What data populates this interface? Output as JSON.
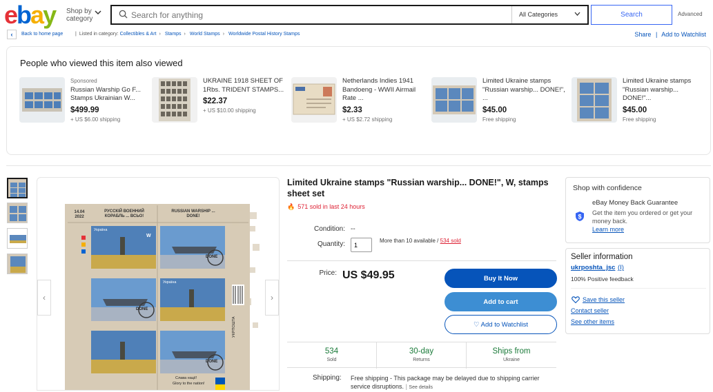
{
  "header": {
    "logo_letters": [
      {
        "ch": "e",
        "color": "#e53238"
      },
      {
        "ch": "b",
        "color": "#0064d2"
      },
      {
        "ch": "a",
        "color": "#f5af02"
      },
      {
        "ch": "y",
        "color": "#86b817"
      }
    ],
    "shop_by_line1": "Shop by",
    "shop_by_line2": "category",
    "search_placeholder": "Search for anything",
    "category_select": "All Categories",
    "search_button": "Search",
    "advanced": "Advanced"
  },
  "breadcrumb": {
    "back_home": "Back to home page",
    "listed_in": "Listed in category:",
    "items": [
      "Collectibles & Art",
      "Stamps",
      "World Stamps",
      "Worldwide Postal History Stamps"
    ],
    "share": "Share",
    "add_watchlist": "Add to Watchlist"
  },
  "also_viewed": {
    "title": "People who viewed this item also viewed",
    "items": [
      {
        "sponsored": "Sponsored",
        "title": "Russian Warship Go F... Stamps Ukrainian W...",
        "price": "$499.99",
        "shipping": "+ US $6.00 shipping"
      },
      {
        "sponsored": "",
        "title": "UKRAINE 1918 SHEET OF 1Rbs. TRIDENT STAMPS...",
        "price": "$22.37",
        "shipping": "+ US $10.00 shipping"
      },
      {
        "sponsored": "",
        "title": "Netherlands Indies 1941 Bandoeng - WWII Airmail Rate ...",
        "price": "$2.33",
        "shipping": "+ US $2.72 shipping"
      },
      {
        "sponsored": "",
        "title": "Limited Ukraine stamps \"Russian warship... DONE!\", ...",
        "price": "$45.00",
        "shipping": "Free shipping"
      },
      {
        "sponsored": "",
        "title": "Limited Ukraine stamps \"Russian warship... DONE!\"...",
        "price": "$45.00",
        "shipping": "Free shipping"
      }
    ]
  },
  "item": {
    "title": "Limited Ukraine stamps \"Russian warship... DONE!\", W, stamps sheet set",
    "hot_text": "571 sold in last 24 hours",
    "condition_label": "Condition:",
    "condition_value": "--",
    "quantity_label": "Quantity:",
    "quantity_value": "1",
    "available": "More than 10 available /",
    "sold_link": "534 sold",
    "price_label": "Price:",
    "price": "US $49.95",
    "buy_now": "Buy It Now",
    "add_to_cart": "Add to cart",
    "add_to_watchlist": "Add to Watchlist",
    "stats": [
      {
        "big": "534",
        "small": "Sold"
      },
      {
        "big": "30-day",
        "small": "Returns"
      },
      {
        "big": "Ships from",
        "small": "Ukraine"
      }
    ],
    "shipping_label": "Shipping:",
    "shipping_value": "Free shipping - This package may be delayed due to shipping carrier service disruptions.",
    "see_details": "See details",
    "stamp_sheet_text": {
      "date": "14.04 2022",
      "left_header": "РУССКІЙ ВОЕННИЙ КОРАБЛЬ ... ВСЬО!",
      "right_header": "RUSSIAN WARSHIP ... DONE!",
      "country": "Україна",
      "value": "W",
      "done": "DONE",
      "slogan_ua": "Слава нації!",
      "slogan_en": "Glory to the nation!",
      "post": "УКРПОШТА"
    }
  },
  "confidence": {
    "title": "Shop with confidence",
    "mbg_title": "eBay Money Back Guarantee",
    "mbg_desc": "Get the item you ordered or get your money back.",
    "learn_more": "Learn more"
  },
  "seller": {
    "title": "Seller information",
    "name": "ukrposhta_jsc",
    "score": "(I)",
    "feedback": "100% Positive feedback",
    "save": "Save this seller",
    "contact": "Contact seller",
    "see_other": "See other items"
  }
}
